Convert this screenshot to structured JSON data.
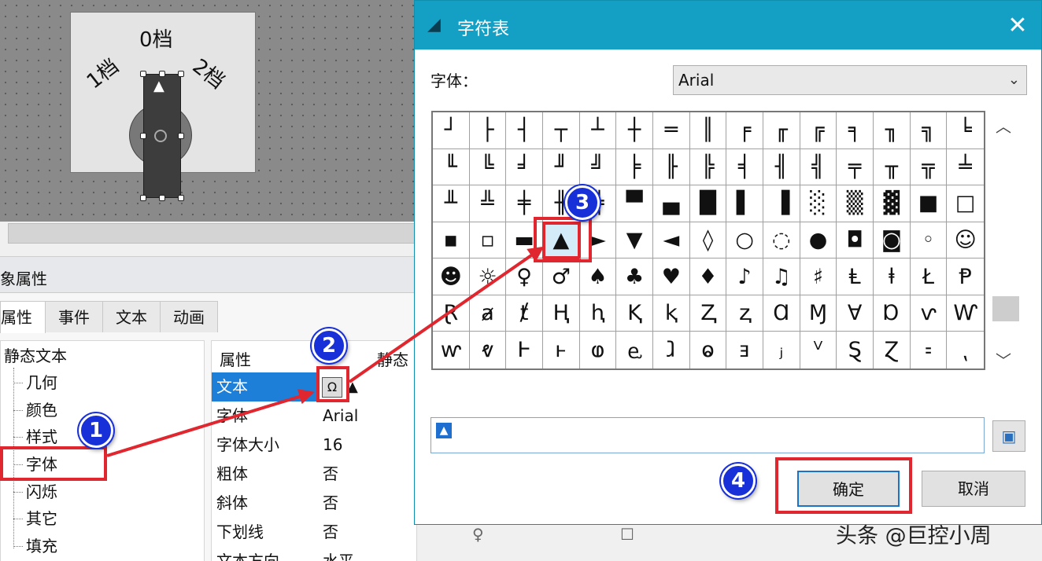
{
  "canvas": {
    "knob_labels": {
      "top": "0档",
      "left": "1档",
      "right": "2档"
    },
    "knob_arrow": "▲"
  },
  "props_panel": {
    "title": "象属性",
    "tabs": [
      {
        "label": "属性"
      },
      {
        "label": "事件"
      },
      {
        "label": "文本"
      },
      {
        "label": "动画"
      }
    ],
    "tree": {
      "root": "静态文本",
      "children": [
        "几何",
        "颜色",
        "样式",
        "字体",
        "闪烁",
        "其它",
        "填充"
      ]
    },
    "grid": {
      "col_property": "属性",
      "col_static": "静态",
      "rows": [
        {
          "name": "文本",
          "value": "▲",
          "button_icon": "Ω"
        },
        {
          "name": "字体",
          "value": "Arial"
        },
        {
          "name": "字体大小",
          "value": "16"
        },
        {
          "name": "粗体",
          "value": "否"
        },
        {
          "name": "斜体",
          "value": "否"
        },
        {
          "name": "下划线",
          "value": "否"
        },
        {
          "name": "文本方向",
          "value": "水平"
        }
      ]
    }
  },
  "dialog": {
    "title": "字符表",
    "close_glyph": "✕",
    "font_label": "字体：",
    "font_value": "Arial",
    "chars": [
      [
        "┘",
        "├",
        "┤",
        "┬",
        "┴",
        "┼",
        "═",
        "║",
        "╒",
        "╓",
        "╔",
        "╕",
        "╖",
        "╗",
        "╘"
      ],
      [
        "╙",
        "╚",
        "╛",
        "╜",
        "╝",
        "╞",
        "╟",
        "╠",
        "╡",
        "╢",
        "╣",
        "╤",
        "╥",
        "╦",
        "╧"
      ],
      [
        "╨",
        "╩",
        "╪",
        "╫",
        "╬",
        "▀",
        "▄",
        "█",
        "▌",
        "▐",
        "░",
        "▒",
        "▓",
        "■",
        "□"
      ],
      [
        "▪",
        "▫",
        "▬",
        "▲",
        "►",
        "▼",
        "◄",
        "◊",
        "○",
        "◌",
        "●",
        "◘",
        "◙",
        "◦",
        "☺"
      ],
      [
        "☻",
        "☼",
        "♀",
        "♂",
        "♠",
        "♣",
        "♥",
        "♦",
        "♪",
        "♫",
        "♯",
        "Ⱡ",
        "ⱡ",
        "Ł",
        "Ᵽ"
      ],
      [
        "Ɽ",
        "ⱥ",
        "ⱦ",
        "Ⱨ",
        "ⱨ",
        "Ⱪ",
        "ⱪ",
        "Ⱬ",
        "ⱬ",
        "Ɑ",
        "Ɱ",
        "Ɐ",
        "Ɒ",
        "ⱱ",
        "Ⱳ"
      ],
      [
        "ⱳ",
        "ⱴ",
        "Ⱶ",
        "ⱶ",
        "ⱷ",
        "ⱸ",
        "ⱹ",
        "ⱺ",
        "ⱻ",
        "ⱼ",
        "ⱽ",
        "Ȿ",
        "Ɀ",
        "⹀",
        "⹁"
      ]
    ],
    "selected_char": "▲",
    "copy_value": "▲",
    "select_button_icon": "▣",
    "ok_label": "确定",
    "cancel_label": "取消"
  },
  "annotations": {
    "markers": [
      "1",
      "2",
      "3",
      "4"
    ],
    "accent_color": "#e0262e",
    "marker_color": "#1730d8"
  },
  "watermark": "头条 @巨控小周"
}
